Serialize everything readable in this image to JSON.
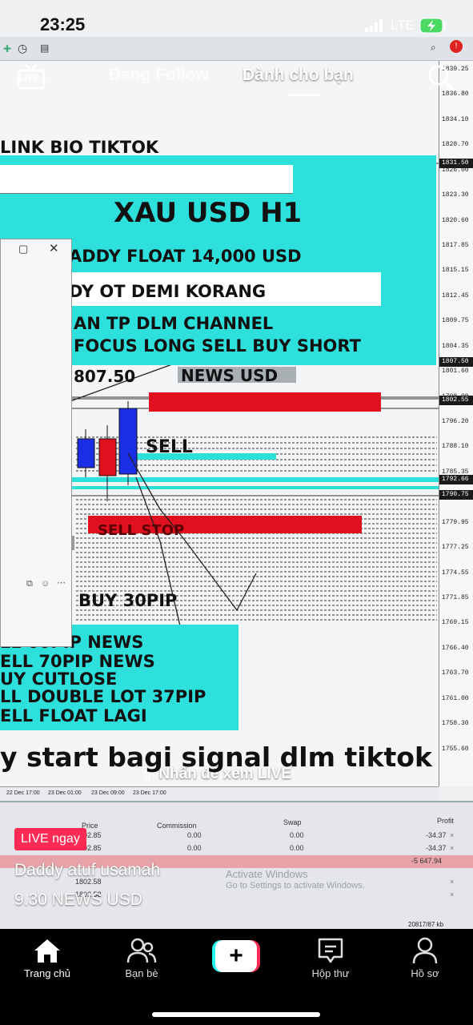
{
  "status_bar": {
    "time": "23:25",
    "network": "LTE"
  },
  "top_tabs": {
    "live_label": "LIVE",
    "following": "Đang Follow",
    "for_you": "Dành cho bạn"
  },
  "chart": {
    "banner_top": "LINK BIO TIKTOK",
    "symbol_title": "XAU USD H1",
    "float_line": "ADDY FLOAT 14,000 USD",
    "line2": "DY OT DEMI KORANG",
    "line3": "AN TP DLM CHANNEL",
    "line4": "FOCUS LONG SELL BUY SHORT",
    "price_label": "807.50",
    "news_label": "NEWS USD",
    "sell_label": "SELL",
    "sell_stop_label": "SELL STOP",
    "buy_label": "BUY 30PIP",
    "list": [
      "LL 60PIP NEWS",
      "ELL 70PIP NEWS",
      "UY CUTLOSE",
      "LL DOUBLE LOT 37PIP",
      "ELL FLOAT LAGI"
    ],
    "footer_text": "y start bagi signal dlm tiktok",
    "price_ticks": [
      "1839.25",
      "1836.80",
      "1834.10",
      "1828.70",
      "1826.00",
      "1823.30",
      "1820.60",
      "1817.85",
      "1815.15",
      "1812.45",
      "1809.75",
      "1804.35",
      "1801.60",
      "1798.90",
      "1796.20",
      "1788.10",
      "1785.35",
      "1782.65",
      "1779.95",
      "1777.25",
      "1774.55",
      "1771.85",
      "1769.15",
      "1766.40",
      "1763.70",
      "1761.00",
      "1758.30",
      "1755.60"
    ],
    "price_flags": [
      "1831.50",
      "1807.50",
      "1802.55",
      "1792.66",
      "1790.75"
    ],
    "time_ticks": [
      "22 Dec 17:00",
      "23 Dec 01:00",
      "23 Dec 09:00",
      "23 Dec 17:00"
    ]
  },
  "terminal": {
    "headers": {
      "price": "Price",
      "commission": "Commission",
      "swap": "Swap",
      "profit": "Profit"
    },
    "rows": [
      {
        "price": "1802.85",
        "commission": "0.00",
        "swap": "0.00",
        "profit": "-34.37"
      },
      {
        "price": "1802.85",
        "commission": "0.00",
        "swap": "0.00",
        "profit": "-34.37"
      },
      {
        "price": "",
        "commission": "",
        "swap": "",
        "profit": "-5 647.94"
      },
      {
        "price": "1802.58",
        "commission": "",
        "swap": "",
        "profit": ""
      },
      {
        "price": "1802.58",
        "commission": "",
        "swap": "",
        "profit": ""
      }
    ],
    "activate_title": "Activate Windows",
    "activate_sub": "Go to Settings to activate Windows.",
    "status_kb": "20817/87 kb"
  },
  "overlay": {
    "live_hint": "Nhấn để xem LIVE",
    "live_badge": "LIVE ngay",
    "username": "Daddy atuf usamah",
    "caption": "9.30 NEWS USD"
  },
  "nav": {
    "home": "Trang chủ",
    "friends": "Bạn bè",
    "inbox": "Hộp thư",
    "profile": "Hồ sơ"
  },
  "colors": {
    "tiktok_pink": "#fe2c55",
    "tiktok_cyan": "#25f4ee",
    "chart_cyan": "#2ee0dc",
    "sell_red": "#e0101f",
    "candle_blue": "#1a2ee6"
  }
}
